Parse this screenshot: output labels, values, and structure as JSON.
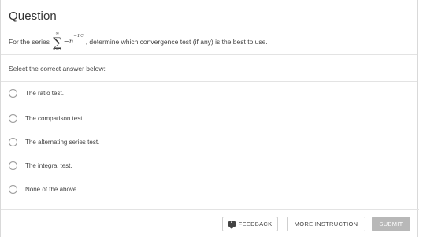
{
  "question": {
    "title": "Question",
    "prompt_before": "For the series",
    "series_upper": "∞",
    "series_symbol": "∑",
    "series_lower": "n=1",
    "term_base": "−n",
    "term_exponent": "−1/3",
    "prompt_after": ", determine which convergence test (if any) is the best to use."
  },
  "instruction": "Select the correct answer below:",
  "options": [
    {
      "label": "The ratio test."
    },
    {
      "label": "The comparison test."
    },
    {
      "label": "The alternating series test."
    },
    {
      "label": "The integral test."
    },
    {
      "label": "None of the above."
    }
  ],
  "footer": {
    "feedback_label": "FEEDBACK",
    "more_instruction_label": "MORE INSTRUCTION",
    "submit_label": "SUBMIT",
    "feedback_icon": "feedback-icon"
  },
  "colors": {
    "border": "#d9d9d9",
    "submit_bg": "#b8b8b8",
    "text": "#444444"
  }
}
